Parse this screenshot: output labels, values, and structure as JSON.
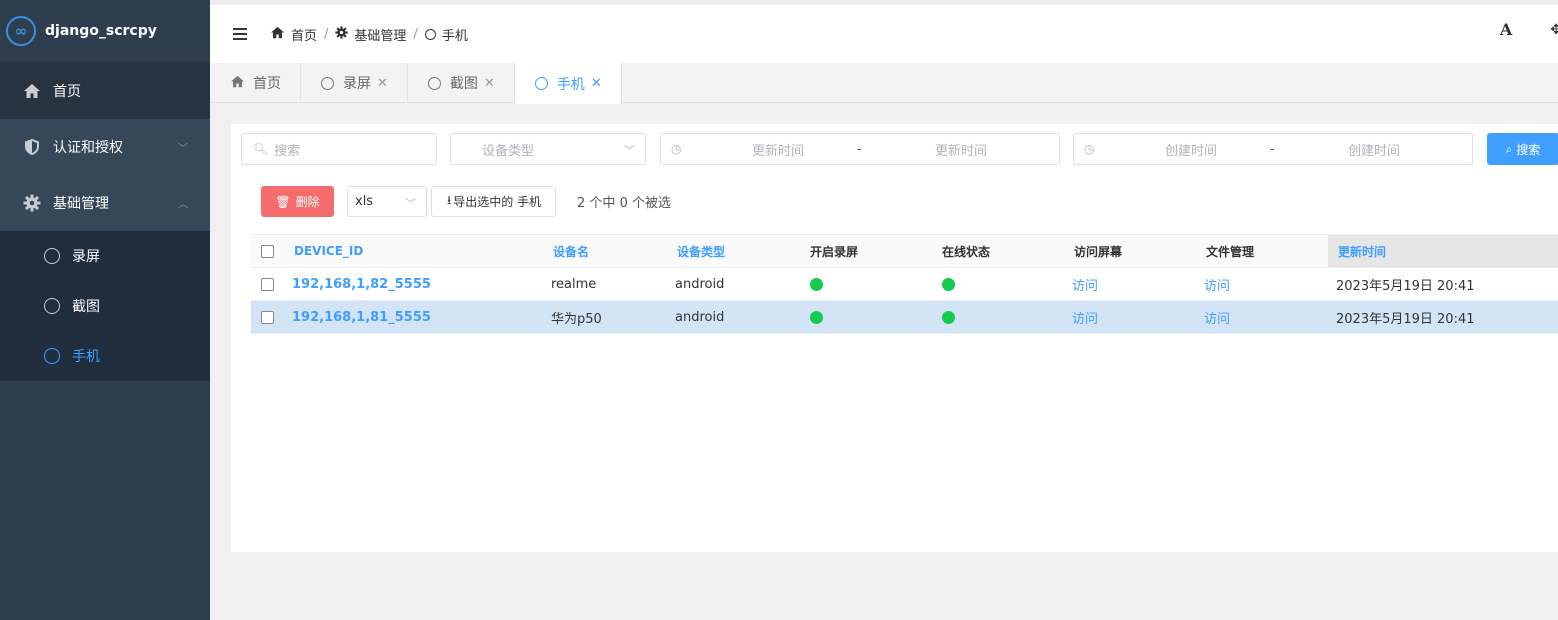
{
  "app": {
    "name": "django_scrcpy",
    "logo": "∞"
  },
  "sidebar": {
    "items": [
      {
        "label": "首页",
        "icon": "home-icon"
      },
      {
        "label": "认证和授权",
        "icon": "shield-icon"
      },
      {
        "label": "基础管理",
        "icon": "gear-icon"
      }
    ],
    "subitems": [
      {
        "label": "录屏"
      },
      {
        "label": "截图"
      },
      {
        "label": "手机"
      }
    ]
  },
  "header": {
    "breadcrumb": [
      "首页",
      "基础管理",
      "手机"
    ]
  },
  "tabs": [
    {
      "label": "首页"
    },
    {
      "label": "录屏"
    },
    {
      "label": "截图"
    },
    {
      "label": "手机"
    }
  ],
  "search": {
    "keyword_placeholder": "搜索",
    "device_type_placeholder": "设备类型",
    "update_start": "更新时间",
    "update_end": "更新时间",
    "create_start": "创建时间",
    "create_end": "创建时间",
    "range_sep": "-",
    "button": "搜索"
  },
  "toolbar": {
    "delete": "删除",
    "format": "xls",
    "export": "导出选中的 手机",
    "selection": "2 个中 0 个被选"
  },
  "table": {
    "columns": [
      "DEVICE_ID",
      "设备名",
      "设备类型",
      "开启录屏",
      "在线状态",
      "访问屏幕",
      "文件管理",
      "更新时间"
    ],
    "rows": [
      {
        "device_id": "192,168,1,82_5555",
        "name": "realme",
        "type": "android",
        "record": "on",
        "online": "on",
        "screen": "访问",
        "files": "访问",
        "updated": "2023年5月19日 20:41"
      },
      {
        "device_id": "192,168,1,81_5555",
        "name": "华为p50",
        "type": "android",
        "record": "on",
        "online": "on",
        "screen": "访问",
        "files": "访问",
        "updated": "2023年5月19日 20:41"
      }
    ]
  },
  "colors": {
    "accent": "#409eff",
    "danger": "#f56c6c",
    "status_on": "#16c94f",
    "sidebar": "#2f3e4e"
  }
}
